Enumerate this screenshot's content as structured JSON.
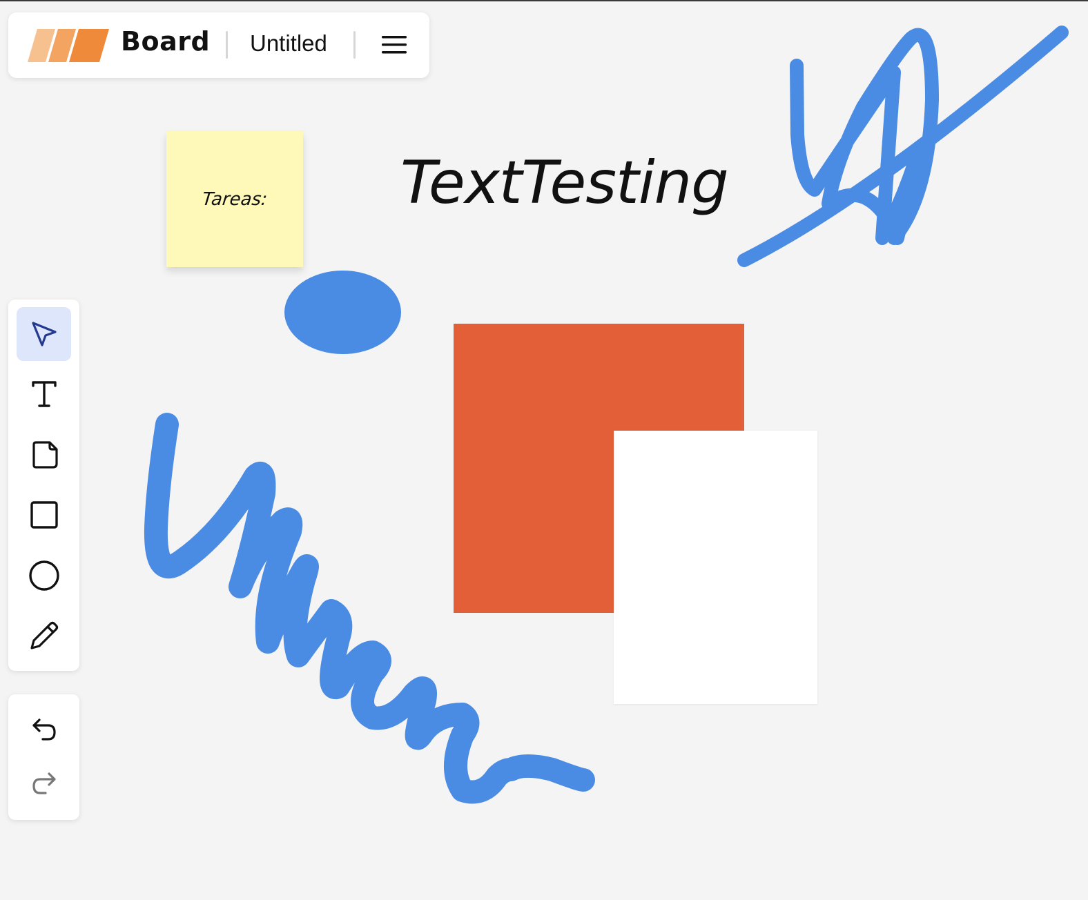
{
  "header": {
    "brand": "Board",
    "document_title": "Untitled",
    "menu_icon": "hamburger-icon"
  },
  "toolbar": {
    "tools": [
      {
        "name": "select",
        "icon": "cursor-arrow-icon",
        "active": true
      },
      {
        "name": "text",
        "icon": "text-icon",
        "active": false
      },
      {
        "name": "sticky-note",
        "icon": "sticky-note-icon",
        "active": false
      },
      {
        "name": "rectangle",
        "icon": "square-icon",
        "active": false
      },
      {
        "name": "ellipse",
        "icon": "circle-icon",
        "active": false
      },
      {
        "name": "pencil",
        "icon": "pencil-icon",
        "active": false
      }
    ]
  },
  "history": {
    "undo_icon": "undo-icon",
    "redo_icon": "redo-icon",
    "redo_enabled": false
  },
  "board": {
    "sticky_note": {
      "text": "Tareas:",
      "color": "#fef9b9"
    },
    "text_element": {
      "text": "TextTesting"
    },
    "shapes": {
      "ellipse_color": "#4a8be3",
      "orange_rect_color": "#e35f37",
      "white_rect_color": "#ffffff"
    },
    "stroke_color": "#4a8be3"
  },
  "colors": {
    "background": "#f4f4f4",
    "active_tool_bg": "#dde6fb",
    "accent_orange": "#ef8a3a"
  }
}
